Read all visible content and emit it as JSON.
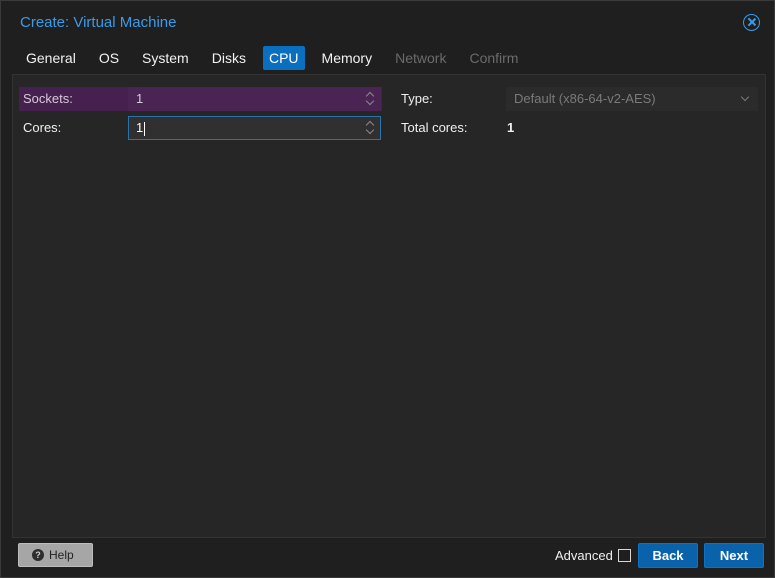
{
  "window": {
    "title": "Create: Virtual Machine"
  },
  "tabs": [
    {
      "label": "General",
      "state": "normal"
    },
    {
      "label": "OS",
      "state": "normal"
    },
    {
      "label": "System",
      "state": "normal"
    },
    {
      "label": "Disks",
      "state": "normal"
    },
    {
      "label": "CPU",
      "state": "active"
    },
    {
      "label": "Memory",
      "state": "normal"
    },
    {
      "label": "Network",
      "state": "disabled"
    },
    {
      "label": "Confirm",
      "state": "disabled"
    }
  ],
  "form": {
    "sockets": {
      "label": "Sockets:",
      "value": "1"
    },
    "cores": {
      "label": "Cores:",
      "value": "1"
    },
    "type": {
      "label": "Type:",
      "value": "Default (x86-64-v2-AES)"
    },
    "total_cores": {
      "label": "Total cores:",
      "value": "1"
    }
  },
  "footer": {
    "help_label": "Help",
    "advanced_label": "Advanced",
    "back_label": "Back",
    "next_label": "Next"
  },
  "colors": {
    "accent": "#0a6fbf",
    "title": "#3b9be8",
    "highlight": "#46214f"
  }
}
